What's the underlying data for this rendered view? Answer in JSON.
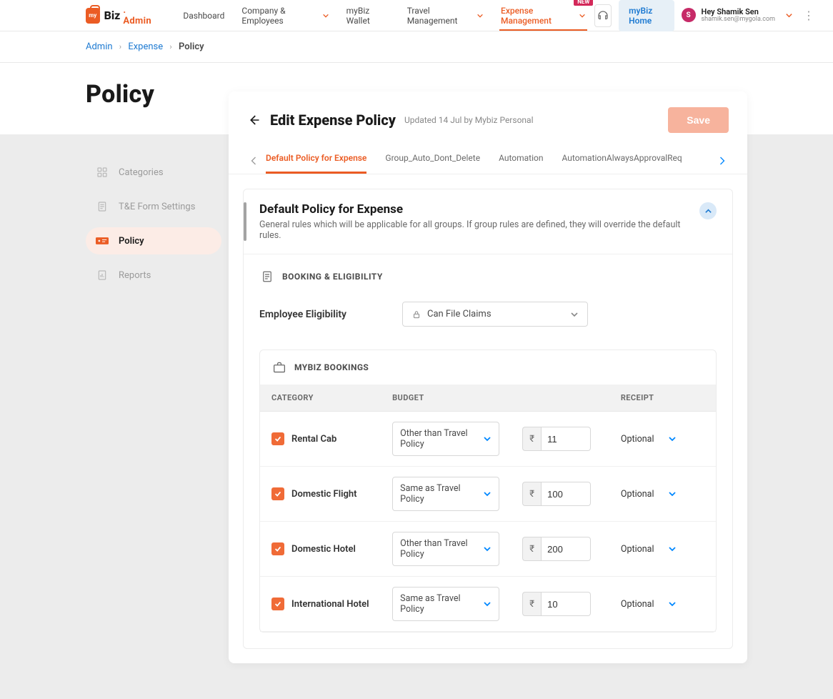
{
  "header": {
    "logo_badge": "my",
    "logo_text": "Biz",
    "logo_suffix": ". Admin",
    "nav": [
      {
        "label": "Dashboard",
        "chev": false
      },
      {
        "label": "Company & Employees",
        "chev": true
      },
      {
        "label": "myBiz Wallet",
        "chev": false
      },
      {
        "label": "Travel Management",
        "chev": true
      },
      {
        "label": "Expense Management",
        "chev": true,
        "active": true,
        "badge": "NEW"
      }
    ],
    "mybiz_home": "myBiz Home",
    "user": {
      "initials": "S",
      "greeting": "Hey Shamik Sen",
      "email": "shamik.sen@mygola.com"
    }
  },
  "breadcrumb": {
    "items": [
      "Admin",
      "Expense",
      "Policy"
    ]
  },
  "page": {
    "title": "Policy"
  },
  "sidebar": {
    "items": [
      {
        "icon": "grid",
        "label": "Categories"
      },
      {
        "icon": "form",
        "label": "T&E Form Settings"
      },
      {
        "icon": "ticket",
        "label": "Policy",
        "active": true
      },
      {
        "icon": "report",
        "label": "Reports"
      }
    ]
  },
  "panel": {
    "title": "Edit Expense Policy",
    "subtitle": "Updated 14 Jul by Mybiz Personal",
    "save": "Save",
    "tabs": [
      "Default Policy for Expense",
      "Group_Auto_Dont_Delete",
      "Automation",
      "AutomationAlwaysApprovalReq"
    ],
    "active_tab": 0
  },
  "card": {
    "title": "Default Policy for Expense",
    "desc": "General rules which will be applicable for all groups. If group rules are defined, they will override the default rules."
  },
  "booking_section": {
    "head": "BOOKING & ELIGIBILITY",
    "elig_label": "Employee Eligibility",
    "elig_value": "Can File Claims"
  },
  "bookings": {
    "head": "MYBIZ BOOKINGS",
    "columns": [
      "CATEGORY",
      "BUDGET",
      "",
      "RECEIPT"
    ],
    "rows": [
      {
        "checked": true,
        "category": "Rental Cab",
        "budget": "Other than Travel Policy",
        "amount": "11",
        "receipt": "Optional"
      },
      {
        "checked": true,
        "category": "Domestic Flight",
        "budget": "Same as Travel Policy",
        "amount": "100",
        "receipt": "Optional"
      },
      {
        "checked": true,
        "category": "Domestic Hotel",
        "budget": "Other than Travel Policy",
        "amount": "200",
        "receipt": "Optional"
      },
      {
        "checked": true,
        "category": "International Hotel",
        "budget": "Same as Travel Policy",
        "amount": "10",
        "receipt": "Optional"
      }
    ]
  }
}
